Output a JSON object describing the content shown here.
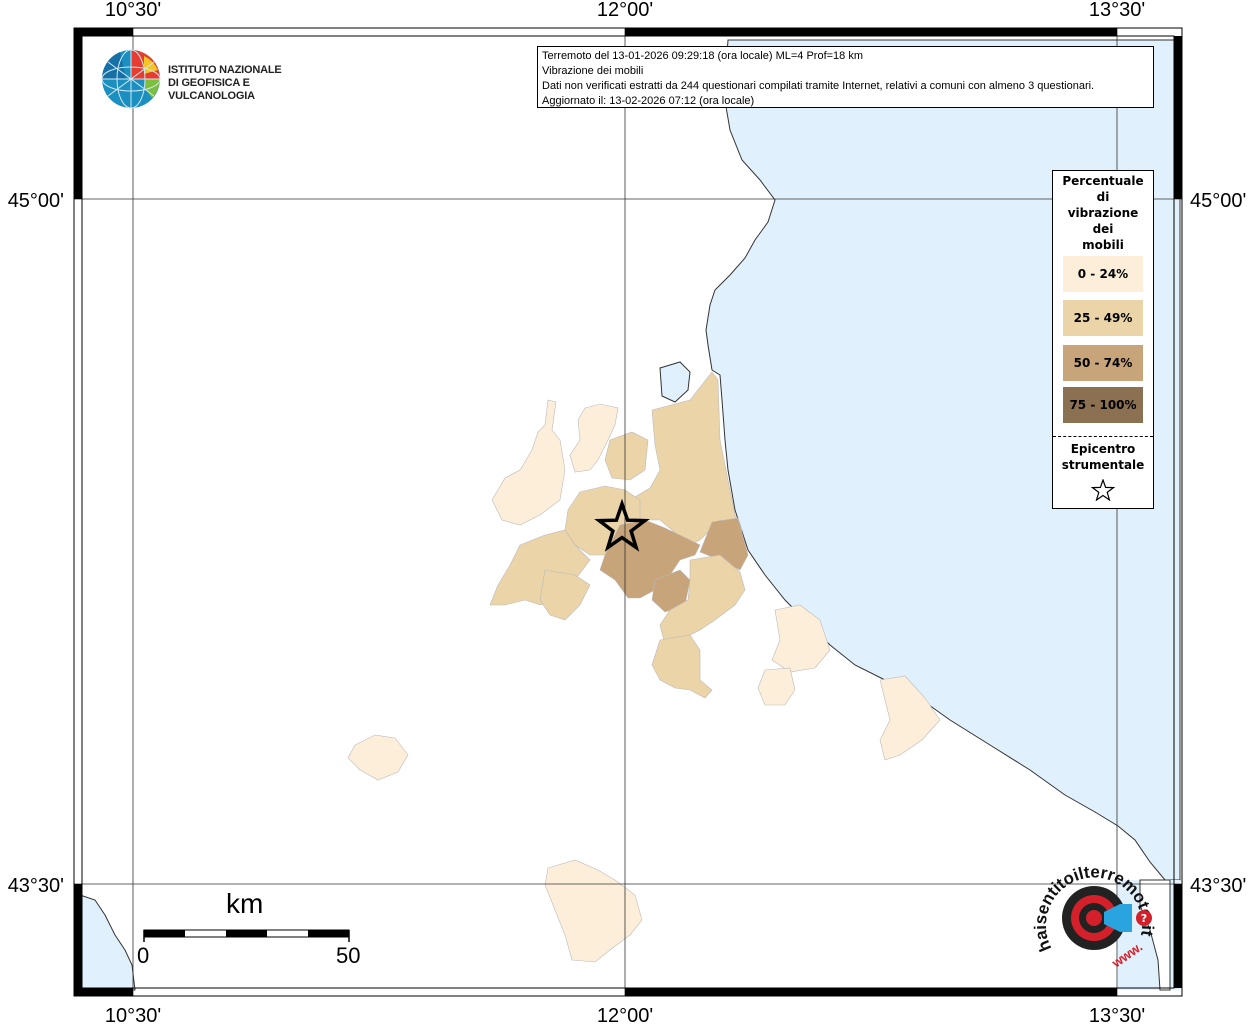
{
  "info": {
    "line1": "Terremoto del 13-01-2026 09:29:18 (ora locale) ML=4 Prof=18 km",
    "line2": "Vibrazione dei mobili",
    "line3": "Dati non verificati estratti da 244 questionari compilati tramite Internet, relativi a comuni con almeno 3 questionari.",
    "line4": "Aggiornato il: 13-02-2026 07:12 (ora locale)"
  },
  "logo": {
    "line1": "ISTITUTO NAZIONALE",
    "line2": "DI GEOFISICA E VULCANOLOGIA"
  },
  "legend": {
    "title_lines": [
      "Percentuale",
      "di",
      "vibrazione",
      "dei",
      "mobili"
    ],
    "classes": [
      {
        "label": "0 - 24%",
        "color": "#fdeed9"
      },
      {
        "label": "25 - 49%",
        "color": "#ebd4a8"
      },
      {
        "label": "50 - 74%",
        "color": "#c7a47a"
      },
      {
        "label": "75 - 100%",
        "color": "#8b7052"
      }
    ],
    "epicenter_label": "Epicentro strumentale"
  },
  "axes": {
    "lon_ticks": [
      "10°30'",
      "12°00'",
      "13°30'"
    ],
    "lat_ticks": [
      "45°00'",
      "43°30'"
    ]
  },
  "scalebar": {
    "unit": "km",
    "min": "0",
    "max": "50"
  },
  "colors": {
    "sea": "#e0f0fc",
    "land": "#ffffff",
    "coast": "#333333"
  },
  "brand": {
    "text": "haisentitoilterremoto.it",
    "www": "www."
  }
}
